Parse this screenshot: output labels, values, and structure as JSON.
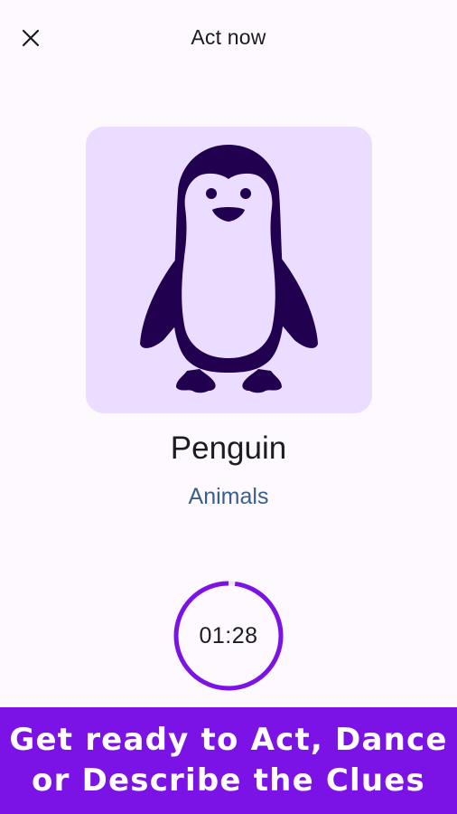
{
  "header": {
    "title": "Act now",
    "close_icon": "close-icon"
  },
  "card": {
    "image_icon": "penguin-icon",
    "background_color": "#eaddff",
    "figure_color": "#21004f",
    "word": "Penguin",
    "category": "Animals"
  },
  "timer": {
    "time_text": "01:28",
    "ring_color": "#7b12e6",
    "remaining_fraction": 0.98
  },
  "banner": {
    "line1": "Get ready to Act, Dance",
    "line2": "or Describe the Clues",
    "background_color": "#7b12e6"
  }
}
